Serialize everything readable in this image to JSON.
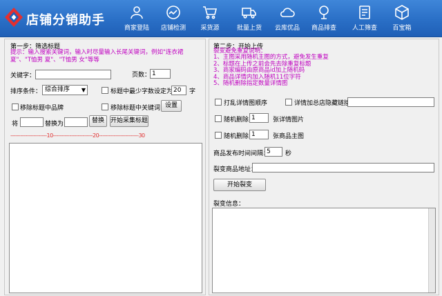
{
  "app": {
    "title": "店铺分销助手"
  },
  "nav": [
    {
      "label": "商家登陆",
      "icon": "user-group-icon"
    },
    {
      "label": "店铺检测",
      "icon": "chart-circle-icon"
    },
    {
      "label": "采货源",
      "icon": "cart-icon"
    },
    {
      "label": "批量上货",
      "icon": "truck-icon"
    },
    {
      "label": "云库优品",
      "icon": "cloud-icon"
    },
    {
      "label": "商品排查",
      "icon": "search-icon"
    },
    {
      "label": "人工筛查",
      "icon": "document-icon"
    },
    {
      "label": "百宝箱",
      "icon": "box-icon"
    }
  ],
  "left": {
    "section_title": "第一步：筛选标题",
    "tip": "提示：输入搜索关键词，输入时尽量输入长尾关键词，例如\"连衣裙夏\"、\"T恤男 夏\"、\"T恤男 女\"等等",
    "keyword_label": "关键字：",
    "keyword_value": "",
    "pages_label": "页数：",
    "pages_value": "1",
    "sort_label": "排序条件：",
    "sort_value": "综合排序",
    "min_chars_label": "标题中最少字数设定为",
    "min_chars_value": "20",
    "min_chars_unit": "字",
    "remove_brand_label": "移除标题中品牌",
    "remove_keyword_label": "移除标题中关键词",
    "settings_button": "设置",
    "replace_label": "将",
    "replace_from": "",
    "replace_to_label": "替换为",
    "replace_to": "",
    "replace_button": "替换",
    "collect_button": "开始采集标题",
    "ruler_marks": [
      "10",
      "20",
      "30"
    ]
  },
  "right": {
    "section_title": "第二步：开始上传",
    "tips_title": "裂变避免重复说明：",
    "tips": [
      "1、主图采用随机主图的方式，避免发生重复",
      "2、标题在上传之前会先去除重复标题",
      "3、商家编码由原商品id加上随机码",
      "4、商品详情内加入随机11位字符",
      "5、随机删除指定数量详情图"
    ],
    "shuffle_label": "打乱详情图顺序",
    "detail_link_label": "详情加总店隐藏链接",
    "detail_link_value": "",
    "delete_detail_label": "随机删除",
    "delete_detail_value": "1",
    "delete_detail_unit": "张详情图片",
    "delete_main_label": "随机删除",
    "delete_main_value": "1",
    "delete_main_unit": "张商品主图",
    "interval_label": "商品发布时间间隔：",
    "interval_value": "5",
    "interval_unit": "秒",
    "address_label": "裂变商品地址：",
    "address_value": "",
    "start_button": "开始裂变",
    "info_label": "裂变信息："
  }
}
